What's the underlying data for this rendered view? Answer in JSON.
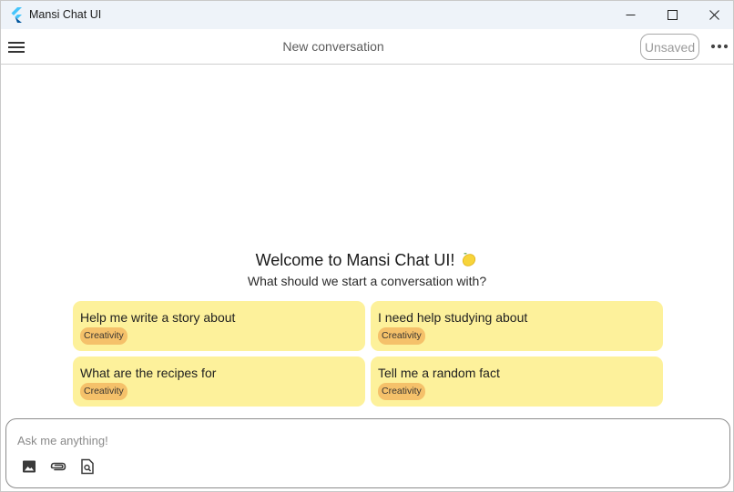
{
  "window": {
    "title": "Mansi Chat UI"
  },
  "appbar": {
    "conversation_title": "New conversation",
    "status_badge": "Unsaved"
  },
  "welcome": {
    "title": "Welcome to Mansi Chat UI!",
    "emoji": "lemon-icon",
    "subtitle": "What should we start a conversation with?"
  },
  "suggestions": [
    {
      "text": "Help me write a story about",
      "tag": "Creativity"
    },
    {
      "text": "I need help studying about",
      "tag": "Creativity"
    },
    {
      "text": "What are the recipes for",
      "tag": "Creativity"
    },
    {
      "text": "Tell me a random fact",
      "tag": "Creativity"
    }
  ],
  "composer": {
    "placeholder": "Ask me anything!",
    "tools": [
      "image-icon",
      "attach-icon",
      "document-search-icon"
    ]
  },
  "colors": {
    "card_background": "#fdf19b",
    "tag_background": "#f5c16a",
    "titlebar_background": "#eef3f9"
  }
}
